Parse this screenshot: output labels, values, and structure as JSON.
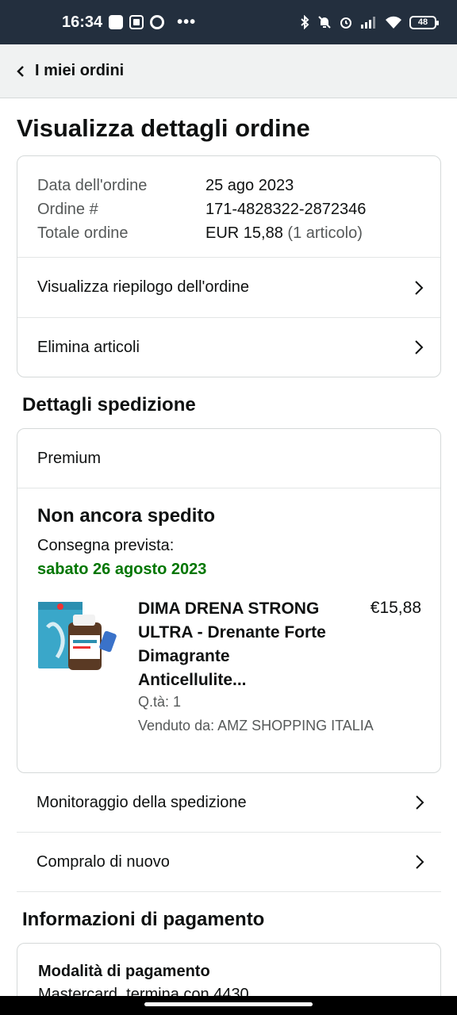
{
  "status_bar": {
    "time": "16:34",
    "battery": "48"
  },
  "topnav": {
    "title": "I miei ordini"
  },
  "page": {
    "title": "Visualizza dettagli ordine"
  },
  "order_summary": {
    "date_label": "Data dell'ordine",
    "date_value": "25 ago 2023",
    "number_label": "Ordine #",
    "number_value": "171-4828322-2872346",
    "total_label": "Totale ordine",
    "total_value": "EUR 15,88",
    "total_items": "(1 articolo)",
    "links": [
      {
        "label": "Visualizza riepilogo dell'ordine"
      },
      {
        "label": "Elimina articoli"
      }
    ]
  },
  "shipping": {
    "section_title": "Dettagli spedizione",
    "type": "Premium",
    "status": "Non ancora spedito",
    "delivery_label": "Consegna prevista:",
    "delivery_date": "sabato 26 agosto 2023",
    "product": {
      "title": "DIMA DRENA STRONG ULTRA - Drenante Forte Dimagrante Anticellulite...",
      "price": "€15,88",
      "quantity": "Q.tà: 1",
      "seller": "Venduto da: AMZ SHOPPING ITALIA"
    },
    "actions": [
      {
        "label": "Monitoraggio della spedizione"
      },
      {
        "label": "Compralo di nuovo"
      }
    ]
  },
  "payment": {
    "section_title": "Informazioni di pagamento",
    "method_title": "Modalità di pagamento",
    "method_value": "Mastercard, termina con 4430"
  },
  "colors": {
    "delivery_green": "#007600",
    "header_dark": "#232f3e",
    "nav_bg": "#f0f2f2"
  }
}
